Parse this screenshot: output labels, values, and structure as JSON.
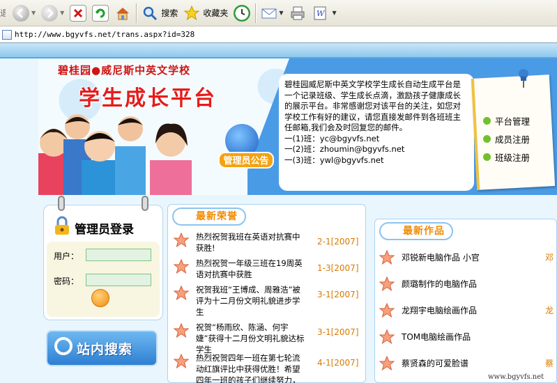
{
  "toolbar": {
    "back_fragment": "退",
    "search_label": "搜索",
    "favorites_label": "收藏夹"
  },
  "address": {
    "url": "http://www.bgyvfs.net/trans.aspx?id=328"
  },
  "header": {
    "school_name": "碧桂园●威尼斯中英文学校",
    "platform_title": "学生成长平台",
    "admin_notice_badge": "管理员公告",
    "notice_lines": [
      "碧桂园威尼斯中英文学校学生成长自动生成平台是一个记录班级、学生成长点滴，激励孩子健康成长的展示平台。非常感谢您对该平台的关注，如您对学校工作有好的建议，请您直接发邮件到各班班主任邮箱,我们会及时回复您的邮件。",
      "一(1)班：yc@bgyvfs.net",
      "一(2)班：zhoumin@bgyvfs.net",
      "一(3)班：ywl@bgyvfs.net"
    ],
    "side_links": [
      "平台管理",
      "成员注册",
      "班级注册"
    ]
  },
  "login": {
    "title": "管理员登录",
    "user_label": "用户：",
    "password_label": "密码：",
    "user_value": "",
    "password_value": ""
  },
  "site_search": {
    "label": "站内搜索"
  },
  "honors": {
    "heading": "最新荣誉",
    "items": [
      {
        "title": "热烈祝贺我班在英语对抗赛中获胜!",
        "date": "2-1[2007]"
      },
      {
        "title": "热烈祝贺一年级三班在19周英语对抗赛中获胜",
        "date": "1-3[2007]"
      },
      {
        "title": "祝贺我班“王博成、周雅浩”被评为十二月份文明礼貌进步学生",
        "date": "3-1[2007]"
      },
      {
        "title": "祝贺“杨雨欣、陈涵、何宇婕”获得十二月份文明礼貌达标学生",
        "date": "3-1[2007]"
      },
      {
        "title": "热烈祝贺四年一班在第七轮流动红旗评比中获得优胜！希望四年一班的孩子们继续努力，争创最优班级！",
        "date": "4-1[2007]"
      }
    ]
  },
  "works": {
    "heading": "最新作品",
    "items": [
      {
        "title": "邓锐新电脑作品 小官",
        "extra": "邓"
      },
      {
        "title": "颜璐制作的电脑作品",
        "extra": ""
      },
      {
        "title": "龙翔宇电脑绘画作品",
        "extra": "龙"
      },
      {
        "title": "TOM电脑绘画作品",
        "extra": ""
      },
      {
        "title": "蔡贤森的可爱脸谱",
        "extra": "蔡"
      }
    ]
  },
  "watermark": "www.bgyvfs.net",
  "colors": {
    "title_red": "#e51c1c",
    "accent_orange": "#f08a00",
    "panel_blue": "#4a9be6",
    "link_green": "#72c12c"
  }
}
